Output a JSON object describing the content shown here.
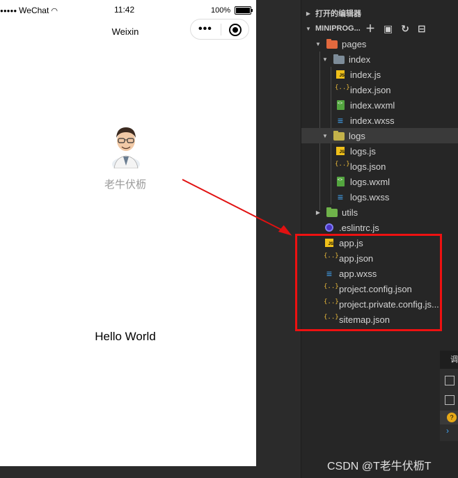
{
  "simulator": {
    "status": {
      "carrier": "WeChat",
      "time": "11:42",
      "battery": "100%"
    },
    "nav_title": "Weixin",
    "user_nickname": "老牛伏枥",
    "greeting": "Hello World"
  },
  "explorer": {
    "open_editors_label": "打开的编辑器",
    "project_label": "MINIPROG...",
    "tree": [
      {
        "label": "pages",
        "kind": "folder",
        "color": "#e2693e"
      },
      {
        "label": "index",
        "kind": "folder",
        "color": "#7d8c99"
      },
      {
        "label": "index.js",
        "kind": "js"
      },
      {
        "label": "index.json",
        "kind": "json"
      },
      {
        "label": "index.wxml",
        "kind": "wxml"
      },
      {
        "label": "index.wxss",
        "kind": "wxss"
      },
      {
        "label": "logs",
        "kind": "folder",
        "color": "#c3b24a"
      },
      {
        "label": "logs.js",
        "kind": "js"
      },
      {
        "label": "logs.json",
        "kind": "json"
      },
      {
        "label": "logs.wxml",
        "kind": "wxml"
      },
      {
        "label": "logs.wxss",
        "kind": "wxss"
      },
      {
        "label": "utils",
        "kind": "folder",
        "color": "#6fb24a"
      },
      {
        "label": ".eslintrc.js",
        "kind": "eslint"
      },
      {
        "label": "app.js",
        "kind": "js"
      },
      {
        "label": "app.json",
        "kind": "json"
      },
      {
        "label": "app.wxss",
        "kind": "wxss"
      },
      {
        "label": "project.config.json",
        "kind": "json"
      },
      {
        "label": "project.private.config.js...",
        "kind": "json"
      },
      {
        "label": "sitemap.json",
        "kind": "json"
      }
    ],
    "json_glyph": "{..}",
    "wxss_glyph": "≡",
    "js_glyph": "JS"
  },
  "annotation": {
    "color": "#e11111"
  },
  "watermark": "CSDN @T老牛伏枥T"
}
